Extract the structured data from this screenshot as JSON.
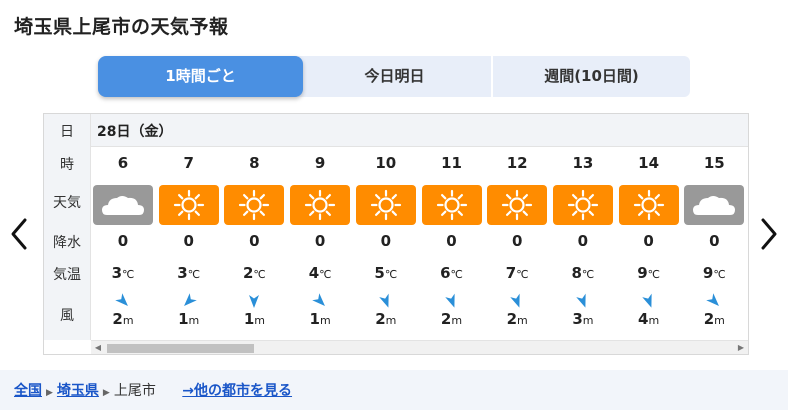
{
  "title": "埼玉県上尾市の天気予報",
  "tabs": [
    {
      "label": "1時間ごと",
      "active": true
    },
    {
      "label": "今日明日",
      "active": false
    },
    {
      "label": "週間(10日間)",
      "active": false
    }
  ],
  "row_labels": {
    "date": "日",
    "hour": "時",
    "weather": "天気",
    "precip": "降水",
    "temp": "気温",
    "wind": "風"
  },
  "date": "28日（金）",
  "temp_unit": "℃",
  "wind_unit": "m",
  "colors": {
    "sunny": "#ff8c00",
    "cloudy": "#999999",
    "accent": "#4a90e2",
    "wind_arrow": "#2a8fd8"
  },
  "hours": [
    {
      "hour": "6",
      "weather": "cloudy-icon",
      "precip": "0",
      "temp": "3",
      "wind_dir_deg": 135,
      "wind": "2"
    },
    {
      "hour": "7",
      "weather": "sunny-icon",
      "precip": "0",
      "temp": "3",
      "wind_dir_deg": 225,
      "wind": "1"
    },
    {
      "hour": "8",
      "weather": "sunny-icon",
      "precip": "0",
      "temp": "2",
      "wind_dir_deg": 180,
      "wind": "1"
    },
    {
      "hour": "9",
      "weather": "sunny-icon",
      "precip": "0",
      "temp": "4",
      "wind_dir_deg": 135,
      "wind": "1"
    },
    {
      "hour": "10",
      "weather": "sunny-icon",
      "precip": "0",
      "temp": "5",
      "wind_dir_deg": 160,
      "wind": "2"
    },
    {
      "hour": "11",
      "weather": "sunny-icon",
      "precip": "0",
      "temp": "6",
      "wind_dir_deg": 160,
      "wind": "2"
    },
    {
      "hour": "12",
      "weather": "sunny-icon",
      "precip": "0",
      "temp": "7",
      "wind_dir_deg": 160,
      "wind": "2"
    },
    {
      "hour": "13",
      "weather": "sunny-icon",
      "precip": "0",
      "temp": "8",
      "wind_dir_deg": 160,
      "wind": "3"
    },
    {
      "hour": "14",
      "weather": "sunny-icon",
      "precip": "0",
      "temp": "9",
      "wind_dir_deg": 160,
      "wind": "4"
    },
    {
      "hour": "15",
      "weather": "cloudy-icon",
      "precip": "0",
      "temp": "9",
      "wind_dir_deg": 135,
      "wind": "2"
    }
  ],
  "footer": {
    "crumbs": [
      "全国",
      "埼玉県"
    ],
    "current": "上尾市",
    "other_link": "→他の都市を見る"
  }
}
